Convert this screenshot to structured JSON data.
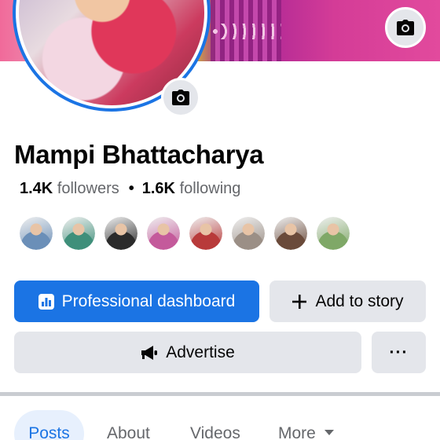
{
  "profile": {
    "name": "Mampi Bhattacharya",
    "followers_count": "1.4K",
    "followers_label": "followers",
    "separator": "•",
    "following_count": "1.6K",
    "following_label": "following"
  },
  "friends": [
    {
      "color": "#6b8fb8"
    },
    {
      "color": "#3f8f7a"
    },
    {
      "color": "#2b2b2b"
    },
    {
      "color": "#c45a9b"
    },
    {
      "color": "#b83a3a"
    },
    {
      "color": "#9b8f86"
    },
    {
      "color": "#6a4a3a"
    },
    {
      "color": "#7fa867"
    }
  ],
  "actions": {
    "professional_dashboard": "Professional dashboard",
    "add_to_story": "Add to story",
    "advertise": "Advertise",
    "more": "···"
  },
  "tabs": {
    "posts": "Posts",
    "about": "About",
    "videos": "Videos",
    "more": "More"
  },
  "colors": {
    "accent": "#1b74e4",
    "button_gray": "#e4e6eb",
    "text_secondary": "#65676b"
  },
  "icons": {
    "cover_camera": "camera-icon",
    "avatar_camera": "camera-icon",
    "dashboard": "bar-chart-icon",
    "add_story": "plus-icon",
    "advertise": "megaphone-icon",
    "more_tab": "caret-down-icon"
  }
}
